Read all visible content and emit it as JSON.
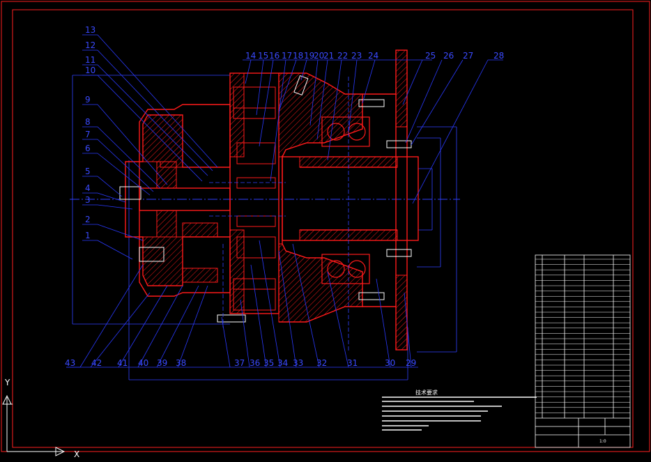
{
  "drawing": {
    "colors": {
      "background": "#000000",
      "frame": "#ff2020",
      "section": "#ff1a1a",
      "centerline": "#3040ff",
      "leader": "#2a3aff",
      "label": "#3a4aff",
      "dimension": "#4050ff",
      "white": "#ffffff"
    },
    "callouts_top": [
      "13",
      "12",
      "11",
      "10",
      "9",
      "8",
      "7",
      "6",
      "5",
      "4",
      "3",
      "2",
      "1"
    ],
    "callouts_row": [
      "14",
      "15",
      "16",
      "17",
      "18",
      "19",
      "20",
      "21",
      "22",
      "23",
      "24",
      "25",
      "26",
      "27",
      "28"
    ],
    "callouts_bottom": [
      "43",
      "42",
      "41",
      "40",
      "39",
      "38",
      "37",
      "36",
      "35",
      "34",
      "33",
      "32",
      "31",
      "30",
      "29"
    ],
    "notes_title": "技术要求",
    "axis": {
      "y": "Y",
      "x": "X"
    },
    "title_block": {
      "scale": "1:0"
    }
  }
}
